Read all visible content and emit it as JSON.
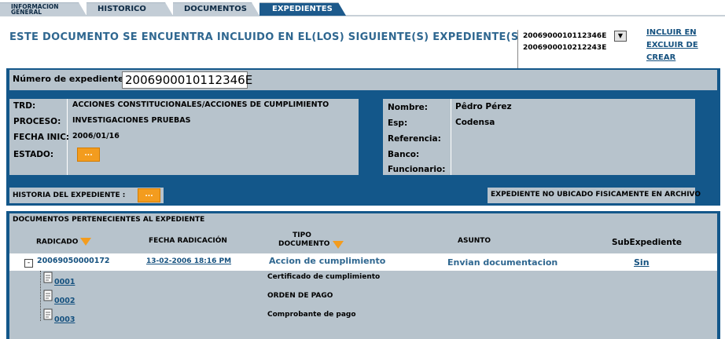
{
  "tabs": [
    {
      "label": "INFORMACION GENERAL"
    },
    {
      "label": "HISTORICO"
    },
    {
      "label": "DOCUMENTOS"
    },
    {
      "label": "EXPEDIENTES"
    }
  ],
  "header": {
    "title": "ESTE DOCUMENTO SE ENCUENTRA INCLUIDO EN EL(LOS) SIGUIENTE(S) EXPEDIENTE(S):",
    "expedientes_list": [
      "2006900010112346E",
      "2006900010212243E"
    ],
    "links": {
      "incluir": "INCLUIR EN",
      "excluir": "EXCLUIR DE",
      "crear": "CREAR"
    }
  },
  "expediente": {
    "numero_label": "Número de expediente",
    "numero_value": "2006900010112346E",
    "left": {
      "trd_label": "TRD:",
      "trd_value": "ACCIONES CONSTITUCIONALES/ACCIONES DE CUMPLIMIENTO",
      "proceso_label": "PROCESO:",
      "proceso_value": "INVESTIGACIONES PRUEBAS",
      "fecha_label": "FECHA INIC:",
      "fecha_value": "2006/01/16",
      "estado_label": "ESTADO:",
      "estado_button": "..."
    },
    "right": {
      "nombre_label": "Nombre:",
      "nombre_value": "Pêdro Pérez",
      "esp_label": "Esp:",
      "esp_value": "Codensa",
      "referencia_label": "Referencia:",
      "banco_label": "Banco:",
      "funcionario_label": "Funcionario:"
    },
    "historia_label": "HISTORIA DEL EXPEDIENTE :",
    "historia_button": "...",
    "ubicacion_status": "EXPEDIENTE NO UBICADO FISICAMENTE EN ARCHIVO"
  },
  "documents": {
    "title": "DOCUMENTOS PERTENECIENTES AL EXPEDIENTE",
    "columns": {
      "radicado": "RADICADO",
      "fecha": "FECHA RADICACIÓN",
      "tipo_line1": "TIPO",
      "tipo_line2": "DOCUMENTO",
      "asunto": "ASUNTO",
      "subexpediente": "SubExpediente"
    },
    "main_row": {
      "expand": "-",
      "radicado": "20069050000172",
      "fecha": "13-02-2006 18:16 PM",
      "tipo": "Accion de cumplimiento",
      "asunto": "Envian documentacion",
      "subexpediente": "Sin"
    },
    "attachments": [
      {
        "id": "0001",
        "desc": "Certificado de cumplimiento"
      },
      {
        "id": "0002",
        "desc": "ORDEN DE PAGO"
      },
      {
        "id": "0003",
        "desc": "Comprobante de pago"
      }
    ]
  },
  "colors": {
    "brand_blue": "#13578a",
    "panel_gray": "#b7c3cc",
    "accent_orange": "#f39c1e",
    "link_blue": "#15517f"
  }
}
